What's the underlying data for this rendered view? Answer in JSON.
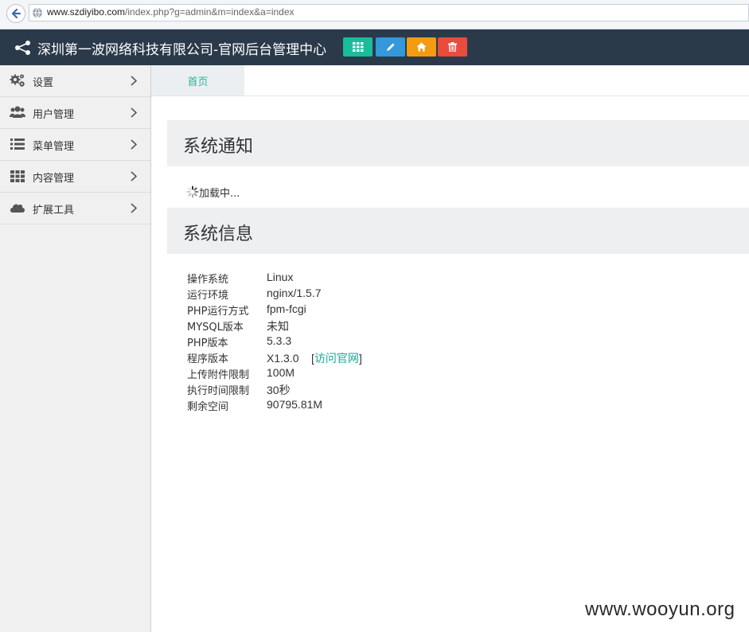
{
  "browser": {
    "url_host": "www.szdiyibo.com",
    "url_path": "/index.php?g=admin&m=index&a=index"
  },
  "header": {
    "title": "深圳第一波网络科技有限公司-官网后台管理中心",
    "buttons": [
      {
        "icon": "grid-icon",
        "color": "#1abc9c"
      },
      {
        "icon": "pencil-icon",
        "color": "#3498db"
      },
      {
        "icon": "home-icon",
        "color": "#f39c12"
      },
      {
        "icon": "trash-icon",
        "color": "#e74c3c"
      }
    ]
  },
  "sidebar": {
    "items": [
      {
        "label": "设置",
        "icon": "gears-icon"
      },
      {
        "label": "用户管理",
        "icon": "users-icon"
      },
      {
        "label": "菜单管理",
        "icon": "list-icon"
      },
      {
        "label": "内容管理",
        "icon": "grid-icon"
      },
      {
        "label": "扩展工具",
        "icon": "cloud-icon"
      }
    ]
  },
  "tabs": {
    "home_label": "首页"
  },
  "notice": {
    "title": "系统通知",
    "loading_text": "加载中..."
  },
  "sysinfo": {
    "title": "系统信息",
    "rows": [
      {
        "key": "操作系统",
        "value": "Linux"
      },
      {
        "key": "运行环境",
        "value": "nginx/1.5.7"
      },
      {
        "key": "PHP运行方式",
        "value": "fpm-fcgi"
      },
      {
        "key": "MYSQL版本",
        "value": "未知"
      },
      {
        "key": "PHP版本",
        "value": "5.3.3"
      },
      {
        "key": "程序版本",
        "value": "X1.3.0",
        "link": "访问官网"
      },
      {
        "key": "上传附件限制",
        "value": "100M"
      },
      {
        "key": "执行时间限制",
        "value": "30秒"
      },
      {
        "key": "剩余空间",
        "value": "90795.81M"
      }
    ]
  },
  "watermark": "www.wooyun.org",
  "colors": {
    "accent": "#1abc9c",
    "topbar": "#2b3a4a",
    "link": "#1aa895"
  }
}
